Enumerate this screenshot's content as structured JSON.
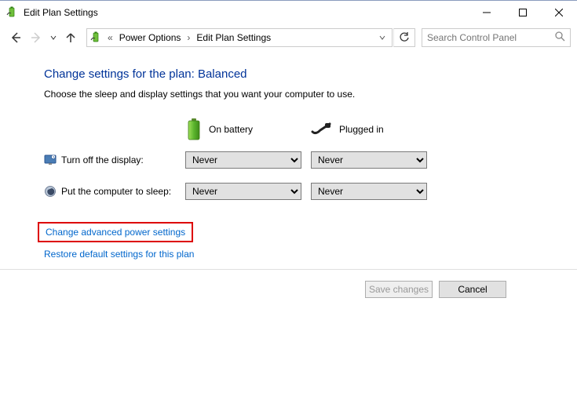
{
  "window": {
    "title": "Edit Plan Settings"
  },
  "breadcrumb": {
    "item1": "Power Options",
    "item2": "Edit Plan Settings"
  },
  "search": {
    "placeholder": "Search Control Panel"
  },
  "heading": "Change settings for the plan: Balanced",
  "subtext": "Choose the sleep and display settings that you want your computer to use.",
  "modes": {
    "battery": "On battery",
    "plugged": "Plugged in"
  },
  "rows": {
    "display": {
      "label": "Turn off the display:",
      "battery_value": "Never",
      "plugged_value": "Never"
    },
    "sleep": {
      "label": "Put the computer to sleep:",
      "battery_value": "Never",
      "plugged_value": "Never"
    }
  },
  "links": {
    "advanced": "Change advanced power settings",
    "restore": "Restore default settings for this plan"
  },
  "buttons": {
    "save": "Save changes",
    "cancel": "Cancel"
  }
}
